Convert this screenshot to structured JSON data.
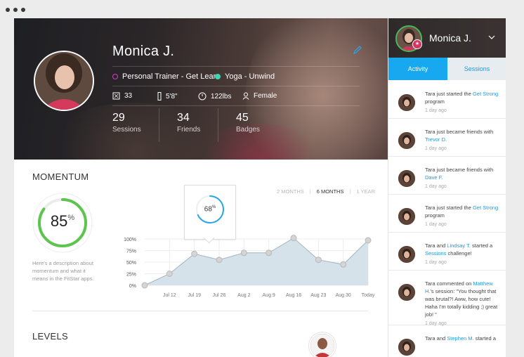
{
  "window_dots": [
    "",
    "",
    ""
  ],
  "profile": {
    "name": "Monica J.",
    "programs": [
      {
        "label": "Personal Trainer - Get Lean",
        "color": "#d63ad0"
      },
      {
        "label": "Yoga - Unwind",
        "color": "#3ed6b0"
      }
    ],
    "age": "33",
    "height": "5'8\"",
    "weight": "122lbs",
    "gender": "Female",
    "counters": [
      {
        "value": "29",
        "label": "Sessions"
      },
      {
        "value": "34",
        "label": "Friends"
      },
      {
        "value": "45",
        "label": "Badges"
      }
    ]
  },
  "momentum": {
    "title": "MOMENTUM",
    "percent": "85",
    "percent_sign": "%",
    "percent_value": 0.85,
    "description": "Here's a description about momentum and what it means in the FitStar apps.",
    "ranges": [
      "2 MONTHS",
      "6 MONTHS",
      "1 YEAR"
    ],
    "selected_range": "6 MONTHS",
    "tooltip": {
      "value": "68",
      "sign": "%",
      "fraction": 0.68
    },
    "accent_green": "#5cc54d",
    "accent_blue": "#25a7e8"
  },
  "chart_data": {
    "type": "area",
    "x": [
      "",
      "Jul 12",
      "Jul 19",
      "Jul 26",
      "Aug 2",
      "Aug 9",
      "Aug 16",
      "Aug 23",
      "Aug 30",
      "Today"
    ],
    "values": [
      0,
      25,
      68,
      55,
      70,
      70,
      102,
      55,
      45,
      97
    ],
    "ylim": [
      0,
      100
    ],
    "yticks": [
      "100%",
      "75%",
      "50%",
      "25%",
      "0%"
    ],
    "ytick_values": [
      100,
      75,
      50,
      25,
      0
    ],
    "grid": true,
    "fill_color": "#d6e2ea",
    "line_color": "#9fb4c3"
  },
  "levels": {
    "title": "LEVELS"
  },
  "sidebar": {
    "user_name": "Monica J.",
    "tabs": [
      {
        "label": "Activity"
      },
      {
        "label": "Sessions"
      }
    ],
    "feed": [
      {
        "pre": "Tara just started the ",
        "link": "Get Strong",
        "post": " program",
        "time": "1 day ago"
      },
      {
        "pre": "Tara just became friends with ",
        "link": "Trevor D.",
        "post": "",
        "time": "1 day ago"
      },
      {
        "pre": "Tara just became friends with ",
        "link": "Dave F.",
        "post": "",
        "time": "1 day ago"
      },
      {
        "pre": "Tara just started the ",
        "link": "Get Strong",
        "post": " program",
        "time": "1 day ago"
      },
      {
        "pre": "Tara and ",
        "link": "Lindsay T.",
        "post": " started a ",
        "link2": "Sessions",
        "post2": " challenge!",
        "time": "1 day ago"
      },
      {
        "pre": "Tara commented on ",
        "link": "Matthew H.",
        "post": "'s session: \"You thought that was brutal?! Aww, how cute! Haha I'm totally kidding ;) great job! \"",
        "time": "1 day ago"
      },
      {
        "pre": "Tara and ",
        "link": "Stephen M.",
        "post": " started a",
        "time": ""
      }
    ]
  }
}
